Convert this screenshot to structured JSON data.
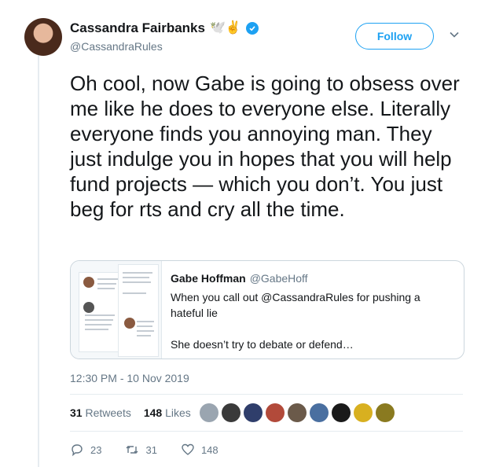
{
  "tweet": {
    "author_name": "Cassandra Fairbanks",
    "author_emojis": "🕊️✌️",
    "author_handle": "@CassandraRules",
    "follow_label": "Follow",
    "text": "Oh cool, now Gabe is going to obsess over me like he does to everyone else. Literally everyone finds you annoying man. They just indulge you in hopes that you will help fund projects — which you don’t. You just beg for rts and cry all the time.",
    "timestamp": "12:30 PM - 10 Nov 2019",
    "retweet_count": "31",
    "retweet_label": "Retweets",
    "like_count": "148",
    "like_label": "Likes"
  },
  "quoted_tweet": {
    "author_name": "Gabe Hoffman",
    "author_handle": "@GabeHoff",
    "text": "When you call out @CassandraRules for pushing a hateful lie\n\nShe doesn’t try to debate or defend…"
  },
  "actions": {
    "replies": "23",
    "retweets": "31",
    "likes": "148"
  },
  "likers": [
    {
      "icon": "liker-avatar",
      "color": "#9aa5b0"
    },
    {
      "icon": "liker-avatar",
      "color": "#3a3a3a"
    },
    {
      "icon": "liker-avatar",
      "color": "#2f3e6b"
    },
    {
      "icon": "liker-avatar",
      "color": "#b24a3a"
    },
    {
      "icon": "liker-avatar",
      "color": "#6b5a4a"
    },
    {
      "icon": "liker-avatar",
      "color": "#4a6fa0"
    },
    {
      "icon": "liker-avatar",
      "color": "#1a1a1a"
    },
    {
      "icon": "liker-avatar",
      "color": "#d8b020"
    },
    {
      "icon": "liker-avatar",
      "color": "#8a7a20"
    }
  ],
  "colors": {
    "accent": "#1da1f2",
    "secondary_text": "#657786",
    "border": "#e6ecf0"
  }
}
